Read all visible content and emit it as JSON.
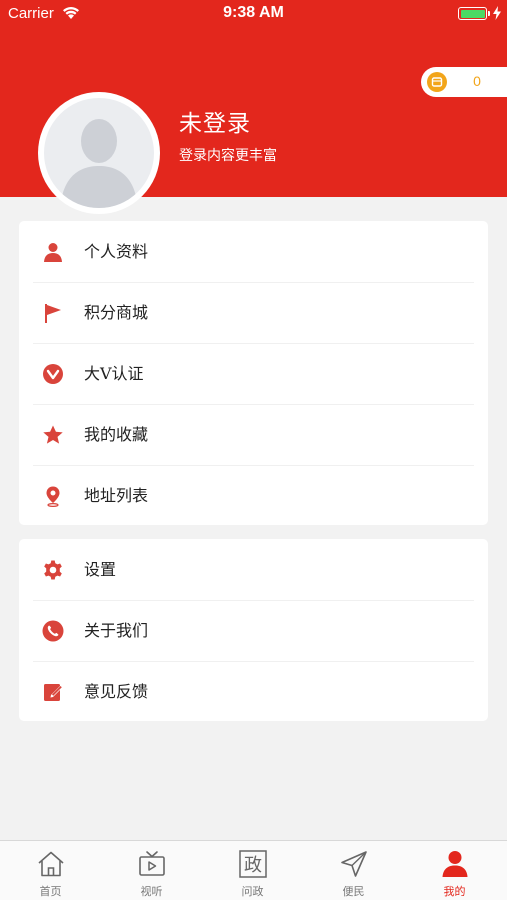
{
  "status_bar": {
    "carrier": "Carrier",
    "time": "9:38 AM"
  },
  "header": {
    "background_color": "#e3271d",
    "login_title": "未登录",
    "login_subtitle": "登录内容更丰富",
    "points_value": "0",
    "points_color": "#f2a51a"
  },
  "menu_group_1": [
    {
      "label": "个人资料",
      "icon": "person-icon"
    },
    {
      "label": "积分商城",
      "icon": "flag-icon"
    },
    {
      "label": "大V认证",
      "icon": "v-badge-icon"
    },
    {
      "label": "我的收藏",
      "icon": "star-icon"
    },
    {
      "label": "地址列表",
      "icon": "location-pin-icon"
    }
  ],
  "menu_group_2": [
    {
      "label": "设置",
      "icon": "gear-icon"
    },
    {
      "label": "关于我们",
      "icon": "phone-icon"
    },
    {
      "label": "意见反馈",
      "icon": "edit-icon"
    }
  ],
  "tabbar": {
    "active_color": "#e3271d",
    "inactive_color": "#777777",
    "items": [
      {
        "label": "首页",
        "icon": "home-icon",
        "active": false
      },
      {
        "label": "视听",
        "icon": "tv-icon",
        "active": false
      },
      {
        "label": "问政",
        "icon": "zheng-icon",
        "icon_text": "政",
        "active": false
      },
      {
        "label": "便民",
        "icon": "paper-plane-icon",
        "active": false
      },
      {
        "label": "我的",
        "icon": "user-icon",
        "active": true
      }
    ]
  }
}
